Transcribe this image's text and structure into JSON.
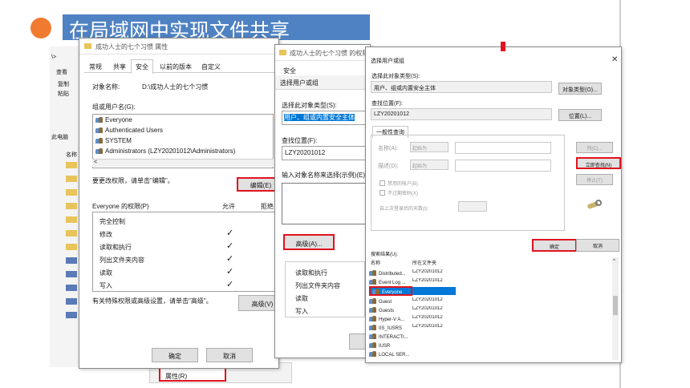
{
  "header": {
    "title": "在局域网中实现文件共享"
  },
  "explorer": {
    "ribbon_items": [
      "查看",
      "复制",
      "粘贴"
    ],
    "nav_items": [
      "此电脑",
      "名称"
    ],
    "bottom_label": "属性(R)"
  },
  "properties": {
    "title": "成功人士的七个习惯 属性",
    "tabs": [
      "常规",
      "共享",
      "安全",
      "以前的版本",
      "自定义"
    ],
    "object_label": "对象名称:",
    "object_value": "D:\\成功人士的七个习惯",
    "group_label": "组或用户名(G):",
    "users": [
      "Everyone",
      "Authenticated Users",
      "SYSTEM",
      "Administrators (LZY20201012\\Administrators)"
    ],
    "change_text": "要更改权限，请单击\"编辑\"。",
    "edit_button": "编辑(E)",
    "perm_header": "Everyone 的权限(P)",
    "allow_header": "允许",
    "deny_header": "拒绝",
    "permissions": [
      "完全控制",
      "修改",
      "读取和执行",
      "列出文件夹内容",
      "读取",
      "写入"
    ],
    "advanced_text": "有关特殊权限或高级设置，请单击\"高级\"。",
    "advanced_button": "高级(V)",
    "ok": "确定",
    "cancel": "取消"
  },
  "select_mid": {
    "title": "成功人士的七个习惯 的权限",
    "tab": "安全",
    "heading": "选择用户或组",
    "type_label": "选择此对象类型(S):",
    "type_value": "用户、组或内置安全主体",
    "loc_label": "查找位置(F):",
    "loc_value": "LZY20201012",
    "enter_label": "输入对象名称来选择(示例)(E):",
    "advanced_button": "高级(A)...",
    "perms": [
      "读取和执行",
      "列出文件夹内容",
      "读取",
      "写入"
    ]
  },
  "select_adv": {
    "title": "选择用户或组",
    "type_label": "选择此对象类型(S):",
    "type_value": "用户、组或内置安全主体",
    "type_button": "对象类型(O)...",
    "loc_label": "查找位置(F):",
    "loc_value": "LZY20201012",
    "loc_button": "位置(L)...",
    "query_tab": "一般性查询",
    "name_label": "名称(A):",
    "name_mode": "起始为",
    "desc_label": "描述(D):",
    "desc_mode": "起始为",
    "columns_button": "列(C)...",
    "find_now_button": "立即查找(N)",
    "stop_button": "停止(T)",
    "disabled_accounts": "禁用的帐户(B)",
    "nonexpiring": "不过期密码(X)",
    "days_label": "自上次登录后的天数(I):",
    "ok": "确定",
    "cancel": "取消",
    "results_label": "搜索结果(U):",
    "col_name": "名称",
    "col_folder": "所在文件夹",
    "results": [
      {
        "name": "Distributed...",
        "folder": "LZY20201012"
      },
      {
        "name": "Event Log ...",
        "folder": "LZY20201012"
      },
      {
        "name": "Everyone",
        "folder": ""
      },
      {
        "name": "Guest",
        "folder": "LZY20201012"
      },
      {
        "name": "Guests",
        "folder": "LZY20201012"
      },
      {
        "name": "Hyper-V A...",
        "folder": "LZY20201012"
      },
      {
        "name": "IIS_IUSRS",
        "folder": "LZY20201012"
      },
      {
        "name": "INTERACTI...",
        "folder": ""
      },
      {
        "name": "IUSR",
        "folder": ""
      },
      {
        "name": "LOCAL SER...",
        "folder": ""
      }
    ]
  },
  "colors": {
    "accent_orange": "#f07a30",
    "title_blue": "#4f82c2",
    "highlight_red": "#e0131e",
    "select_blue": "#0078d7"
  }
}
